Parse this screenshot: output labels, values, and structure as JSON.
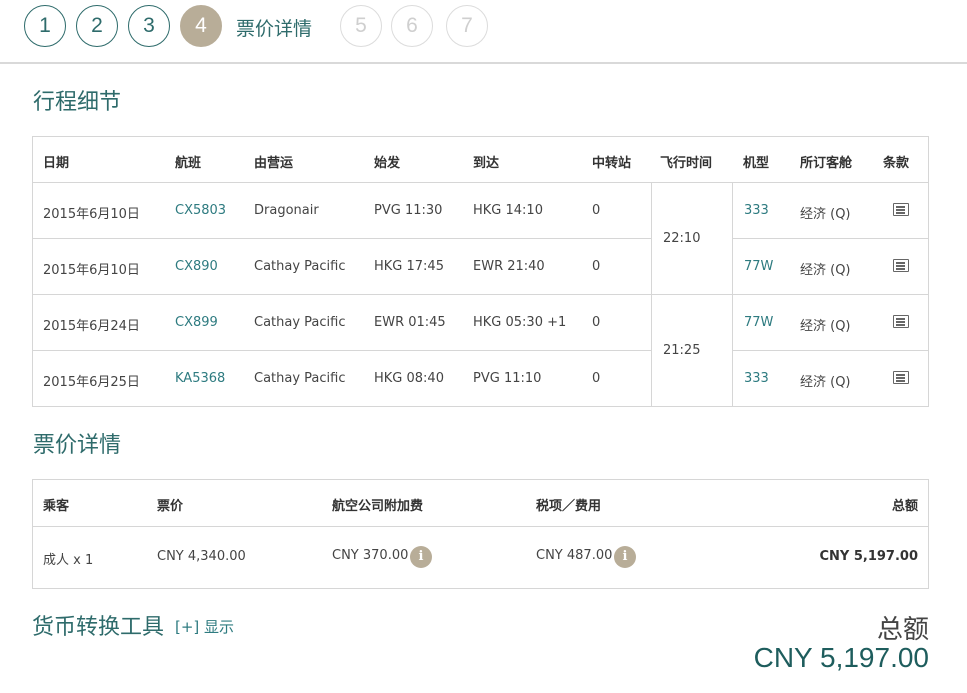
{
  "steps": [
    "1",
    "2",
    "3",
    "4",
    "5",
    "6",
    "7"
  ],
  "current_step_label": "票价详情",
  "itinerary": {
    "title": "行程细节",
    "headers": [
      "日期",
      "航班",
      "由营运",
      "始发",
      "到达",
      "中转站",
      "飞行时间",
      "机型",
      "所订客舱",
      "条款"
    ],
    "rows": [
      {
        "date": "2015年6月10日",
        "flight": "CX5803",
        "operator": "Dragonair",
        "depart": "PVG 11:30",
        "arrive": "HKG 14:10",
        "stops": "0",
        "aircraft": "333",
        "cabin": "经济 (Q)"
      },
      {
        "date": "2015年6月10日",
        "flight": "CX890",
        "operator": "Cathay Pacific",
        "depart": "HKG 17:45",
        "arrive": "EWR 21:40",
        "stops": "0",
        "aircraft": "77W",
        "cabin": "经济 (Q)"
      },
      {
        "date": "2015年6月24日",
        "flight": "CX899",
        "operator": "Cathay Pacific",
        "depart": "EWR 01:45",
        "arrive": "HKG 05:30 +1",
        "stops": "0",
        "aircraft": "77W",
        "cabin": "经济 (Q)"
      },
      {
        "date": "2015年6月25日",
        "flight": "KA5368",
        "operator": "Cathay Pacific",
        "depart": "HKG 08:40",
        "arrive": "PVG 11:10",
        "stops": "0",
        "aircraft": "333",
        "cabin": "经济 (Q)"
      }
    ],
    "durations": [
      "22:10",
      "21:25"
    ]
  },
  "fare": {
    "title": "票价详情",
    "headers": [
      "乘客",
      "票价",
      "航空公司附加费",
      "税项／费用",
      "总额"
    ],
    "row": {
      "passenger": "成人 x 1",
      "fare": "CNY 4,340.00",
      "surcharge": "CNY 370.00",
      "taxes": "CNY 487.00",
      "total": "CNY 5,197.00"
    },
    "info_icon_glyph": "i"
  },
  "converter": {
    "title": "货币转换工具",
    "toggle": "[+] 显示"
  },
  "grand_total": {
    "label": "总额",
    "value": "CNY 5,197.00"
  }
}
